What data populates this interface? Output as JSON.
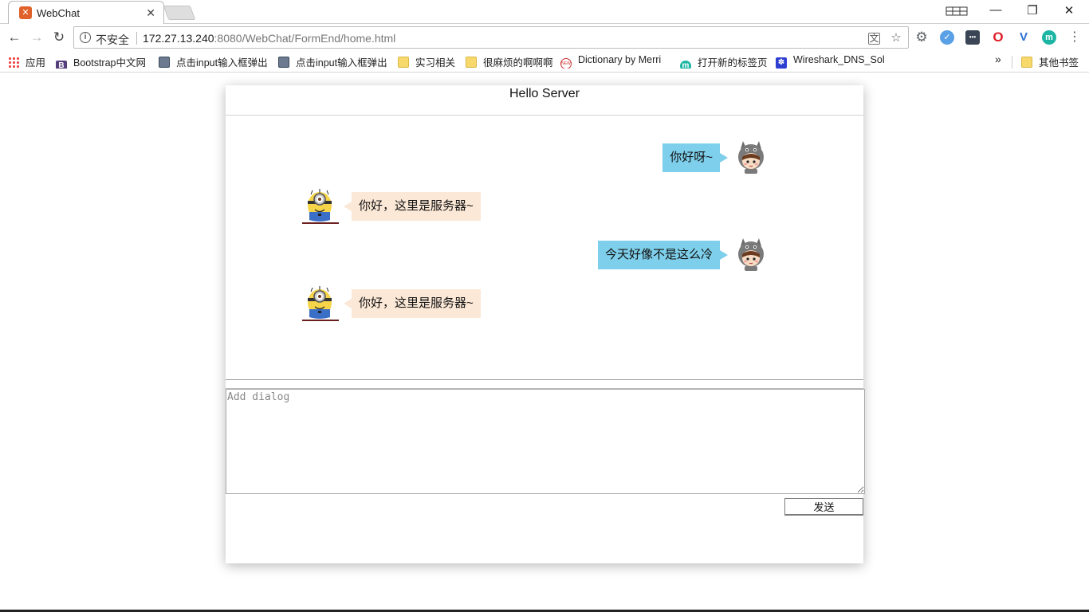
{
  "browser": {
    "tab": {
      "title": "WebChat",
      "favicon": "xampp-icon"
    },
    "window_buttons": {
      "minimize": "—",
      "restore": "❐",
      "close": "✕"
    },
    "nav": {
      "back": "←",
      "forward": "→",
      "reload": "↻"
    },
    "omnibox": {
      "security_label": "不安全",
      "url_host": "172.27.13.240",
      "url_rest": ":8080/WebChat/FormEnd/home.html"
    },
    "extensions": [
      {
        "name": "settings-extension-icon",
        "glyph": "⚙",
        "color": "#5f6368"
      },
      {
        "name": "check-extension-icon",
        "glyph": "✓",
        "color": "#5aa0e6"
      },
      {
        "name": "dashboard-extension-icon",
        "glyph": "•••",
        "color": "#3a4555"
      },
      {
        "name": "opera-extension-icon",
        "glyph": "O",
        "color": "#e0202a"
      },
      {
        "name": "v-extension-icon",
        "glyph": "V",
        "color": "#2c6fd1"
      },
      {
        "name": "m-extension-icon",
        "glyph": "m",
        "color": "#1cb5a3"
      }
    ],
    "bookmarks": [
      {
        "label": "应用",
        "icon": "apps-grid-icon"
      },
      {
        "label": "Bootstrap中文网",
        "icon": "bootstrap-icon"
      },
      {
        "label": "点击input输入框弹出",
        "icon": "page-icon"
      },
      {
        "label": "点击input输入框弹出",
        "icon": "page-icon"
      },
      {
        "label": "实习相关",
        "icon": "folder-icon"
      },
      {
        "label": "很麻烦的啊啊啊",
        "icon": "folder-icon"
      },
      {
        "label": "Dictionary by Merri",
        "icon": "dictionary-icon"
      },
      {
        "label": "打开新的标签页",
        "icon": "m-icon"
      },
      {
        "label": "Wireshark_DNS_Sol",
        "icon": "paw-icon"
      }
    ],
    "more_bookmarks": "»",
    "other_bookmarks": "其他书签"
  },
  "chat": {
    "title": "Hello Server",
    "messages": [
      {
        "side": "right",
        "text": "你好呀~",
        "avatar": "totoro-girl-avatar"
      },
      {
        "side": "left",
        "text": "你好，这里是服务器~",
        "avatar": "minion-avatar"
      },
      {
        "side": "right",
        "text": "今天好像不是这么冷",
        "avatar": "totoro-girl-avatar"
      },
      {
        "side": "left",
        "text": "你好，这里是服务器~",
        "avatar": "minion-avatar"
      }
    ],
    "input": {
      "placeholder": "Add dialog",
      "value": ""
    },
    "send_label": "发送"
  },
  "colors": {
    "client_bubble": "#7ecfeb",
    "server_bubble": "#fbe8d6"
  }
}
